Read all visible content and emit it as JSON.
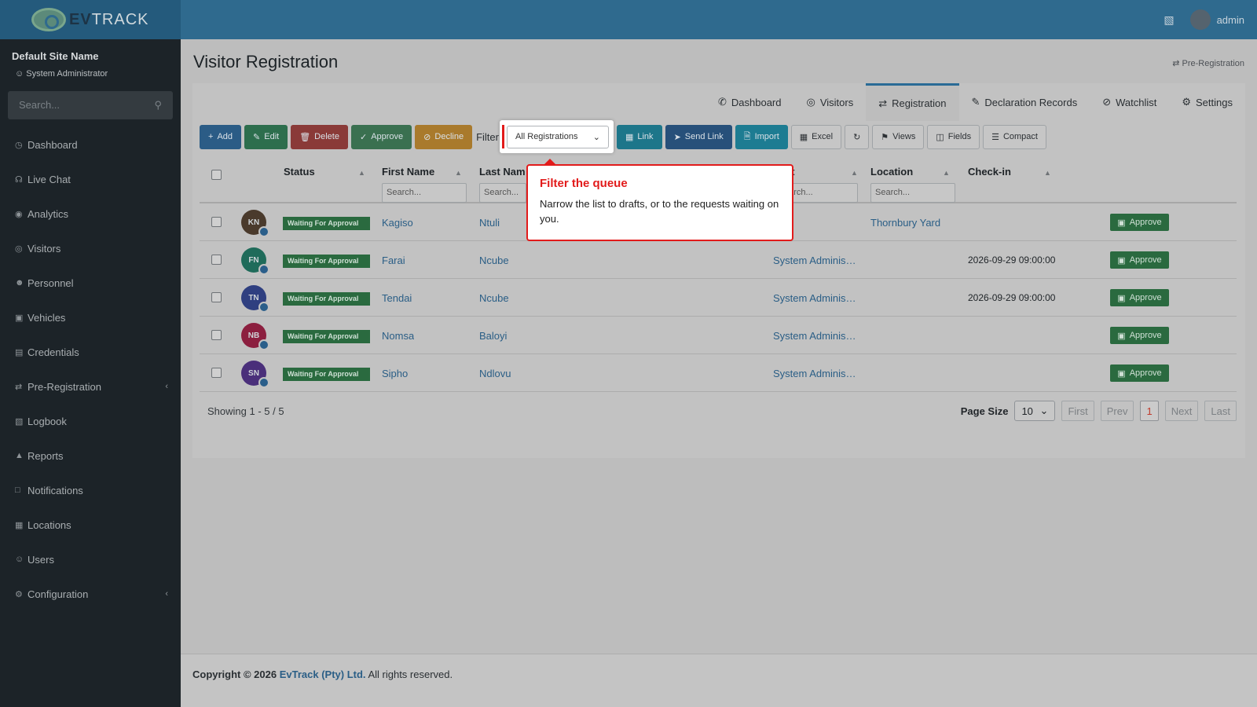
{
  "brand": {
    "logo_bold": "EV",
    "logo_rest": "TRACK"
  },
  "header": {
    "user": "admin"
  },
  "sidebar": {
    "site_name": "Default Site Name",
    "role": "System Administrator",
    "search_placeholder": "Search...",
    "items": [
      {
        "label": "Dashboard",
        "icon": "gauge-icon"
      },
      {
        "label": "Live Chat",
        "icon": "headset-icon"
      },
      {
        "label": "Analytics",
        "icon": "target-icon"
      },
      {
        "label": "Visitors",
        "icon": "eye-icon"
      },
      {
        "label": "Personnel",
        "icon": "users-icon"
      },
      {
        "label": "Vehicles",
        "icon": "car-icon"
      },
      {
        "label": "Credentials",
        "icon": "id-card-icon"
      },
      {
        "label": "Pre-Registration",
        "icon": "arrows-icon"
      },
      {
        "label": "Logbook",
        "icon": "book-icon"
      },
      {
        "label": "Reports",
        "icon": "chart-icon"
      },
      {
        "label": "Notifications",
        "icon": "chat-icon"
      },
      {
        "label": "Locations",
        "icon": "building-icon"
      },
      {
        "label": "Users",
        "icon": "user-cog-icon"
      },
      {
        "label": "Configuration",
        "icon": "gear-icon"
      }
    ]
  },
  "page": {
    "title": "Visitor Registration",
    "breadcrumb": "Pre-Registration"
  },
  "tabs": [
    "Dashboard",
    "Visitors",
    "Registration",
    "Declaration Records",
    "Watchlist",
    "Settings"
  ],
  "active_tab": "Registration",
  "toolbar": {
    "add": "Add",
    "edit": "Edit",
    "delete": "Delete",
    "approve": "Approve",
    "decline": "Decline",
    "filter_label": "Filter",
    "filter_value": "All Registrations",
    "link": "Link",
    "send_link": "Send Link",
    "import": "Import",
    "excel": "Excel",
    "views": "Views",
    "fields": "Fields",
    "compact": "Compact"
  },
  "table": {
    "columns": {
      "status": "Status",
      "first_name": "First Name",
      "last_name": "Last Nam",
      "host": "ost",
      "location": "Location",
      "checkin": "Check-in"
    },
    "search_placeholder": "Search...",
    "host_search_placeholder": "earch...",
    "approve_label": "Approve",
    "rows": [
      {
        "initials": "KN",
        "avatar_color": "#4a3a2c",
        "status": "Waiting For Approval",
        "first": "Kagiso",
        "last": "Ntuli",
        "host": "",
        "location": "Thornbury Yard",
        "checkin": ""
      },
      {
        "initials": "FN",
        "avatar_color": "#1f6b5a",
        "status": "Waiting For Approval",
        "first": "Farai",
        "last": "Ncube",
        "host": "System Administrator",
        "location": "",
        "checkin": "2026-09-29 09:00:00"
      },
      {
        "initials": "TN",
        "avatar_color": "#2f3f80",
        "status": "Waiting For Approval",
        "first": "Tendai",
        "last": "Ncube",
        "host": "System Administrator",
        "location": "",
        "checkin": "2026-09-29 09:00:00"
      },
      {
        "initials": "NB",
        "avatar_color": "#8c1f3f",
        "status": "Waiting For Approval",
        "first": "Nomsa",
        "last": "Baloyi",
        "host": "System Administrator",
        "location": "",
        "checkin": ""
      },
      {
        "initials": "SN",
        "avatar_color": "#4a2f7a",
        "status": "Waiting For Approval",
        "first": "Sipho",
        "last": "Ndlovu",
        "host": "System Administrator",
        "location": "",
        "checkin": ""
      }
    ]
  },
  "pager": {
    "showing": "Showing 1 - 5 / 5",
    "page_size_label": "Page Size",
    "page_size": "10",
    "first": "First",
    "prev": "Prev",
    "current": "1",
    "next": "Next",
    "last": "Last"
  },
  "footer": {
    "prefix": "Copyright © 2026",
    "company": "EvTrack (Pty) Ltd.",
    "suffix": "All rights reserved."
  },
  "popover": {
    "title": "Filter the queue",
    "body": "Narrow the list to drafts, or to the requests waiting on you."
  }
}
